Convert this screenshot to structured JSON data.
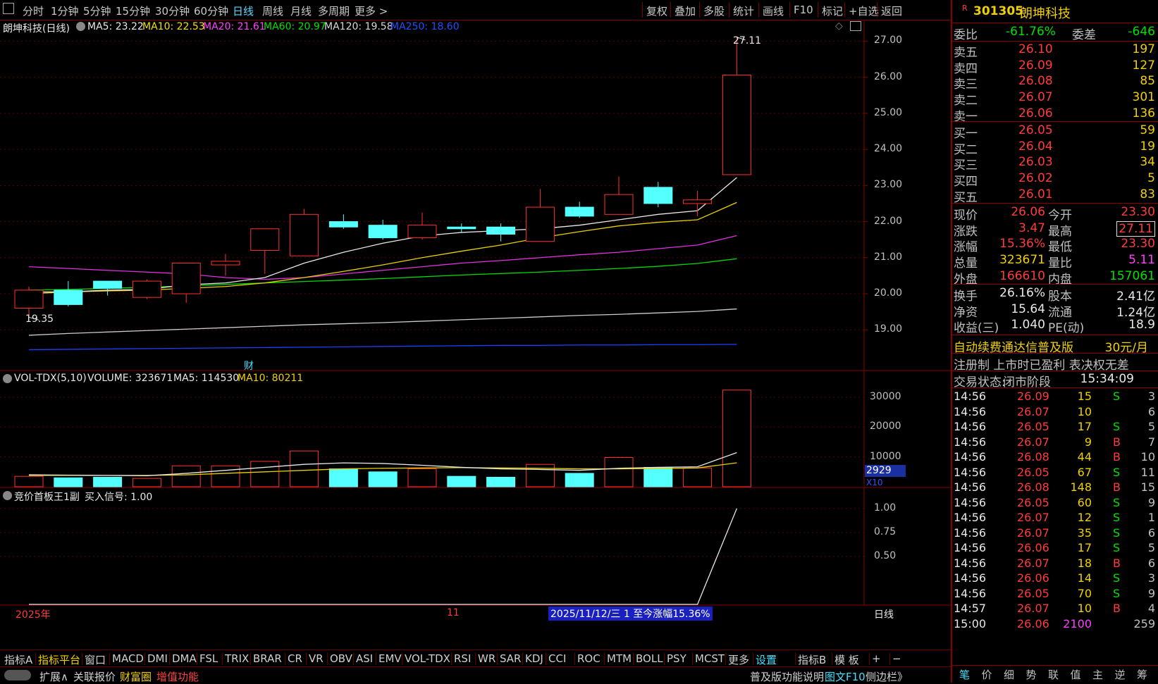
{
  "topbar": {
    "left_tabs": [
      "分时",
      "1分钟",
      "5分钟",
      "15分钟",
      "30分钟",
      "60分钟",
      "日线",
      "周线",
      "月线",
      "多周期",
      "更多 >"
    ],
    "active_tab": "日线",
    "right_buttons": [
      "复权",
      "叠加",
      "多股",
      "统计",
      "画线",
      "F10",
      "标记",
      "+自选",
      "返回"
    ]
  },
  "main_chart": {
    "title": "朗坤科技(日线)",
    "ma_labels": [
      {
        "text": "MA5: 23.22",
        "color": "#e8e8e8"
      },
      {
        "text": "MA10: 22.53",
        "color": "#f0e000"
      },
      {
        "text": "MA20: 21.61",
        "color": "#ff40ff"
      },
      {
        "text": "MA60: 20.97",
        "color": "#00e000"
      },
      {
        "text": "MA120: 19.58",
        "color": "#d8d8d8"
      },
      {
        "text": "MA250: 18.60",
        "color": "#2050ff"
      }
    ],
    "high_label": "27.11",
    "low_label": "19.35",
    "fin_marker": "财",
    "y_ticks": [
      "27.00",
      "26.00",
      "25.00",
      "24.00",
      "23.00",
      "22.00",
      "21.00",
      "20.00",
      "19.00"
    ]
  },
  "chart_data": {
    "type": "candlestick",
    "candles": [
      {
        "o": 19.6,
        "c": 20.1,
        "h": 20.2,
        "l": 19.35
      },
      {
        "o": 20.1,
        "c": 19.7,
        "h": 20.35,
        "l": 19.65
      },
      {
        "o": 20.35,
        "c": 20.15,
        "h": 20.35,
        "l": 19.95
      },
      {
        "o": 19.9,
        "c": 20.35,
        "h": 20.4,
        "l": 19.85
      },
      {
        "o": 20.0,
        "c": 20.85,
        "h": 20.85,
        "l": 19.75
      },
      {
        "o": 20.8,
        "c": 20.9,
        "h": 21.1,
        "l": 20.5
      },
      {
        "o": 21.2,
        "c": 21.8,
        "h": 21.8,
        "l": 20.55
      },
      {
        "o": 21.05,
        "c": 22.2,
        "h": 22.35,
        "l": 21.05
      },
      {
        "o": 22.0,
        "c": 21.85,
        "h": 22.2,
        "l": 21.8
      },
      {
        "o": 21.9,
        "c": 21.55,
        "h": 22.05,
        "l": 21.5
      },
      {
        "o": 21.55,
        "c": 21.9,
        "h": 22.25,
        "l": 21.5
      },
      {
        "o": 21.85,
        "c": 21.8,
        "h": 21.95,
        "l": 21.7
      },
      {
        "o": 21.85,
        "c": 21.65,
        "h": 21.95,
        "l": 21.45
      },
      {
        "o": 21.45,
        "c": 22.4,
        "h": 22.9,
        "l": 21.45
      },
      {
        "o": 22.4,
        "c": 22.15,
        "h": 22.55,
        "l": 22.1
      },
      {
        "o": 22.2,
        "c": 22.75,
        "h": 23.25,
        "l": 22.2
      },
      {
        "o": 22.95,
        "c": 22.5,
        "h": 23.1,
        "l": 22.4
      },
      {
        "o": 22.5,
        "c": 22.6,
        "h": 22.85,
        "l": 22.15
      },
      {
        "o": 23.3,
        "c": 26.06,
        "h": 27.11,
        "l": 23.3
      }
    ],
    "ma5": [
      20.05,
      20.05,
      20.1,
      20.12,
      20.25,
      20.3,
      20.45,
      20.85,
      21.15,
      21.4,
      21.6,
      21.7,
      21.75,
      21.8,
      21.9,
      22.05,
      22.2,
      22.3,
      23.22
    ],
    "ma10": [
      20.0,
      20.05,
      20.08,
      20.1,
      20.15,
      20.2,
      20.3,
      20.45,
      20.62,
      20.8,
      21.0,
      21.18,
      21.35,
      21.55,
      21.72,
      21.88,
      21.98,
      22.05,
      22.53
    ],
    "ma20": [
      20.75,
      20.7,
      20.65,
      20.6,
      20.55,
      20.45,
      20.4,
      20.45,
      20.55,
      20.65,
      20.75,
      20.85,
      20.92,
      21.0,
      21.08,
      21.15,
      21.25,
      21.35,
      21.61
    ],
    "ma60": [
      20.1,
      20.12,
      20.15,
      20.18,
      20.22,
      20.26,
      20.3,
      20.34,
      20.38,
      20.42,
      20.47,
      20.52,
      20.56,
      20.6,
      20.65,
      20.7,
      20.76,
      20.84,
      20.97
    ],
    "ma120": [
      18.85,
      18.9,
      18.94,
      18.98,
      19.02,
      19.06,
      19.1,
      19.14,
      19.17,
      19.2,
      19.24,
      19.28,
      19.32,
      19.36,
      19.4,
      19.43,
      19.47,
      19.51,
      19.58
    ],
    "ma250": [
      18.45,
      18.46,
      18.47,
      18.48,
      18.49,
      18.5,
      18.51,
      18.52,
      18.53,
      18.54,
      18.55,
      18.56,
      18.57,
      18.57,
      18.58,
      18.58,
      18.59,
      18.59,
      18.6
    ],
    "ylim": [
      18.4,
      27.3
    ],
    "volume": [
      3500,
      3000,
      3200,
      2800,
      7000,
      7000,
      8500,
      12000,
      6000,
      5000,
      6000,
      3500,
      3200,
      7500,
      4500,
      9800,
      6500,
      6300,
      32367
    ],
    "vol_ma5": [
      4000,
      3900,
      3800,
      3700,
      4500,
      5500,
      6500,
      7500,
      8000,
      7800,
      7200,
      6500,
      6000,
      5800,
      5500,
      6200,
      6500,
      6700,
      11453
    ],
    "vol_ma10": [
      3800,
      3800,
      3800,
      3800,
      4000,
      4500,
      5000,
      5500,
      6000,
      6200,
      6300,
      6400,
      6300,
      6200,
      6000,
      6000,
      6100,
      6300,
      8021
    ],
    "vol_ylim": [
      0,
      33500
    ],
    "signal": [
      0,
      0,
      0,
      0,
      0,
      0,
      0,
      0,
      0,
      0,
      0,
      0,
      0,
      0,
      0,
      0,
      0,
      0,
      1
    ],
    "signal_ylim": [
      0.0,
      1.05
    ]
  },
  "volume_panel": {
    "title": "VOL-TDX(5,10)",
    "volume_label": "VOLUME: 323671",
    "ma5_label": "MA5: 114530",
    "ma10_label": "MA10: 80211",
    "y_ticks": [
      "30000",
      "20000",
      "10000"
    ],
    "cursor_value": "2929",
    "unit": "X10"
  },
  "indicator_panel": {
    "title": "竞价首板王1副",
    "signal_label": "买入信号: 1.00",
    "y_ticks": [
      "1.00",
      "0.75",
      "0.50"
    ]
  },
  "x_axis": {
    "year_label": "2025年",
    "month_label": "11",
    "range_text": "2025/11/12/三 1 至今涨幅15.36%",
    "period": "日线"
  },
  "bottom_tabs": [
    "指标A",
    "指标平台",
    "窗口",
    "MACD",
    "DMI",
    "DMA",
    "FSL",
    "TRIX",
    "BRAR",
    "CR",
    "VR",
    "OBV",
    "ASI",
    "EMV",
    "VOL-TDX",
    "RSI",
    "WR",
    "SAR",
    "KDJ",
    "CCI",
    "ROC",
    "MTM",
    "BOLL",
    "PSY",
    "MCST",
    "更多",
    "设置",
    "指标B",
    "模 板",
    "+",
    "−"
  ],
  "bottom_bar2": {
    "expand": "扩展∧",
    "items": [
      "关联报价",
      "财富圈",
      "增值功能"
    ],
    "right_items": [
      "普及版功能说明",
      "图文F10",
      "侧边栏》"
    ]
  },
  "panel": {
    "code": "301305",
    "name": "朗坤科技",
    "r_mark": "R",
    "ratio_row": {
      "l1": "委比",
      "v1": "-61.76%",
      "l2": "委差",
      "v2": "-646"
    },
    "sells": [
      {
        "label": "卖五",
        "price": "26.10",
        "vol": "197"
      },
      {
        "label": "卖四",
        "price": "26.09",
        "vol": "127"
      },
      {
        "label": "卖三",
        "price": "26.08",
        "vol": "85"
      },
      {
        "label": "卖二",
        "price": "26.07",
        "vol": "301"
      },
      {
        "label": "卖一",
        "price": "26.06",
        "vol": "136"
      }
    ],
    "buys": [
      {
        "label": "买一",
        "price": "26.05",
        "vol": "59"
      },
      {
        "label": "买二",
        "price": "26.04",
        "vol": "19"
      },
      {
        "label": "买三",
        "price": "26.03",
        "vol": "34"
      },
      {
        "label": "买四",
        "price": "26.02",
        "vol": "5"
      },
      {
        "label": "买五",
        "price": "26.01",
        "vol": "83"
      }
    ],
    "stats": [
      {
        "l1": "现价",
        "v1": "26.06",
        "c1": "#ff3b3b",
        "l2": "今开",
        "v2": "23.30",
        "c2": "#ff3b3b"
      },
      {
        "l1": "涨跌",
        "v1": "3.47",
        "c1": "#ff3b3b",
        "l2": "最高",
        "v2": "27.11",
        "c2": "#ff3b3b"
      },
      {
        "l1": "涨幅",
        "v1": "15.36%",
        "c1": "#ff3b3b",
        "l2": "最低",
        "v2": "23.30",
        "c2": "#ff3b3b"
      },
      {
        "l1": "总量",
        "v1": "323671",
        "c1": "#f0d000",
        "l2": "量比",
        "v2": "5.11",
        "c2": "#ff40ff"
      },
      {
        "l1": "外盘",
        "v1": "166610",
        "c1": "#ff3b3b",
        "l2": "内盘",
        "v2": "157061",
        "c2": "#00e000"
      }
    ],
    "stats2": [
      {
        "l1": "换手",
        "v1": "26.16%",
        "l2": "股本",
        "v2": "2.41亿"
      },
      {
        "l1": "净资",
        "v1": "15.64",
        "l2": "流通",
        "v2": "1.24亿"
      },
      {
        "l1": "收益(三)",
        "v1": "1.040",
        "l2": "PE(动)",
        "v2": "18.9"
      }
    ],
    "promo": "自动续费通达信普及版",
    "promo_price": "30元/月",
    "notice": "注册制 上市时已盈利 表决权无差",
    "trade_status_label": "交易状态:",
    "trade_status": "闭市阶段",
    "trade_time": "15:34:09",
    "ticks": [
      {
        "t": "14:56",
        "p": "26.09",
        "v": "15",
        "s": "S",
        "n": "3"
      },
      {
        "t": "14:56",
        "p": "26.07",
        "v": "10",
        "s": "",
        "n": "6"
      },
      {
        "t": "14:56",
        "p": "26.05",
        "v": "17",
        "s": "S",
        "n": "5"
      },
      {
        "t": "14:56",
        "p": "26.07",
        "v": "9",
        "s": "B",
        "n": "7"
      },
      {
        "t": "14:56",
        "p": "26.08",
        "v": "44",
        "s": "B",
        "n": "10"
      },
      {
        "t": "14:56",
        "p": "26.05",
        "v": "67",
        "s": "S",
        "n": "11"
      },
      {
        "t": "14:56",
        "p": "26.08",
        "v": "148",
        "s": "B",
        "n": "15"
      },
      {
        "t": "14:56",
        "p": "26.05",
        "v": "60",
        "s": "S",
        "n": "9"
      },
      {
        "t": "14:56",
        "p": "26.07",
        "v": "12",
        "s": "S",
        "n": "1"
      },
      {
        "t": "14:56",
        "p": "26.07",
        "v": "35",
        "s": "S",
        "n": "6"
      },
      {
        "t": "14:56",
        "p": "26.06",
        "v": "17",
        "s": "S",
        "n": "5"
      },
      {
        "t": "14:56",
        "p": "26.07",
        "v": "18",
        "s": "B",
        "n": "6"
      },
      {
        "t": "14:56",
        "p": "26.06",
        "v": "14",
        "s": "S",
        "n": "3"
      },
      {
        "t": "14:56",
        "p": "26.05",
        "v": "70",
        "s": "S",
        "n": "9"
      },
      {
        "t": "14:57",
        "p": "26.07",
        "v": "10",
        "s": "B",
        "n": "4"
      },
      {
        "t": "15:00",
        "p": "26.06",
        "v": "2100",
        "s": "",
        "n": "259"
      }
    ],
    "bottom_tabs": [
      "笔",
      "价",
      "细",
      "势",
      "联",
      "值",
      "主",
      "逆",
      "筹"
    ]
  }
}
